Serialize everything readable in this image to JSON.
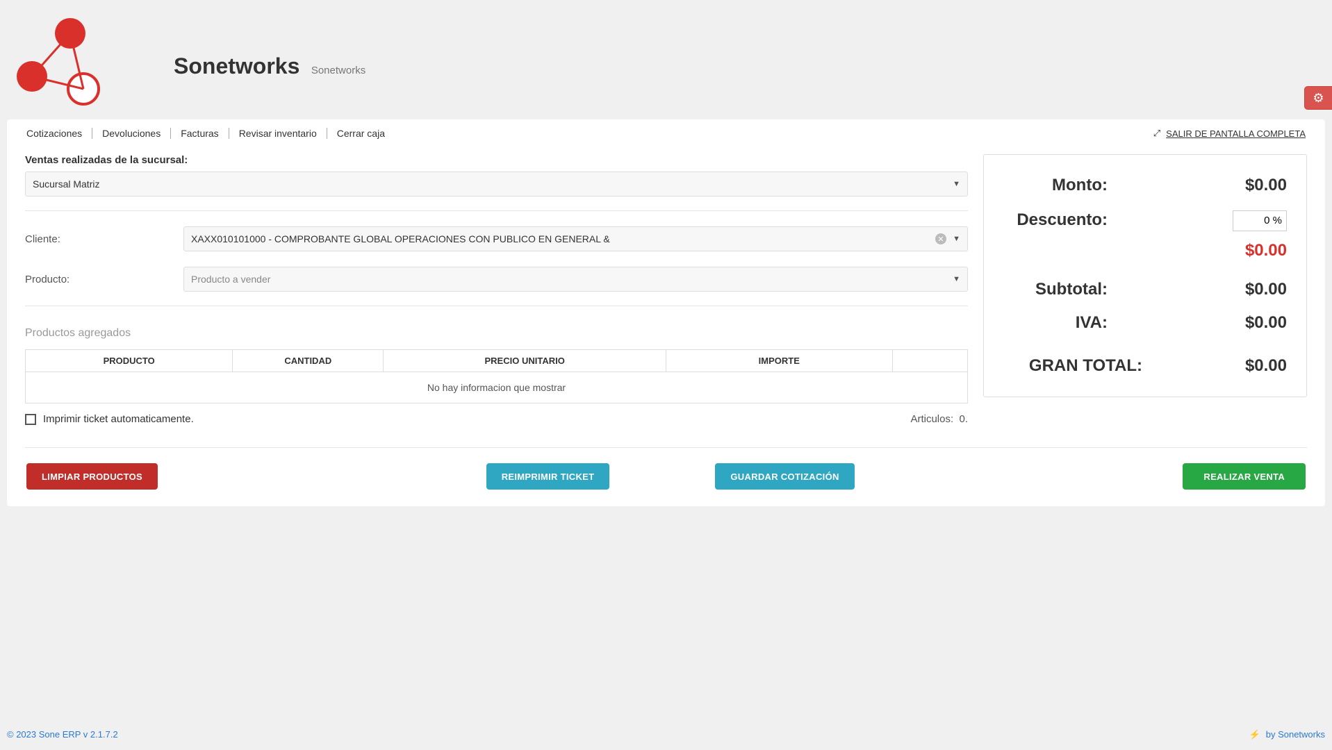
{
  "header": {
    "title": "Sonetworks",
    "subtitle": "Sonetworks",
    "gear_icon": "gear"
  },
  "nav": {
    "items": [
      "Cotizaciones",
      "Devoluciones",
      "Facturas",
      "Revisar inventario",
      "Cerrar caja"
    ],
    "exit_label": "SALIR DE PANTALLA COMPLETA"
  },
  "form": {
    "section_label": "Ventas realizadas de la sucursal:",
    "sucursal_value": "Sucursal Matriz",
    "cliente_label": "Cliente:",
    "cliente_value": "XAXX010101000 - COMPROBANTE GLOBAL OPERACIONES CON PUBLICO EN GENERAL &",
    "producto_label": "Producto:",
    "producto_placeholder": "Producto a vender",
    "agregados_label": "Productos agregados"
  },
  "table": {
    "headers": [
      "PRODUCTO",
      "CANTIDAD",
      "PRECIO UNITARIO",
      "IMPORTE"
    ],
    "empty_message": "No hay informacion que mostrar"
  },
  "below": {
    "auto_print_label": "Imprimir ticket automaticamente.",
    "articles_label": "Articulos:",
    "articles_value": "0."
  },
  "totals": {
    "monto_label": "Monto:",
    "monto_value": "$0.00",
    "descuento_label": "Descuento:",
    "descuento_value": "0 %",
    "descuento_amount": "$0.00",
    "subtotal_label": "Subtotal:",
    "subtotal_value": "$0.00",
    "iva_label": "IVA:",
    "iva_value": "$0.00",
    "grantotal_label": "GRAN TOTAL:",
    "grantotal_value": "$0.00"
  },
  "buttons": {
    "limpiar": "LIMPIAR PRODUCTOS",
    "reimprimir": "REIMPRIMIR TICKET",
    "guardar": "GUARDAR COTIZACIÓN",
    "realizar": "REALIZAR VENTA"
  },
  "footer": {
    "left": "© 2023 Sone ERP v 2.1.7.2",
    "right": "by Sonetworks"
  }
}
